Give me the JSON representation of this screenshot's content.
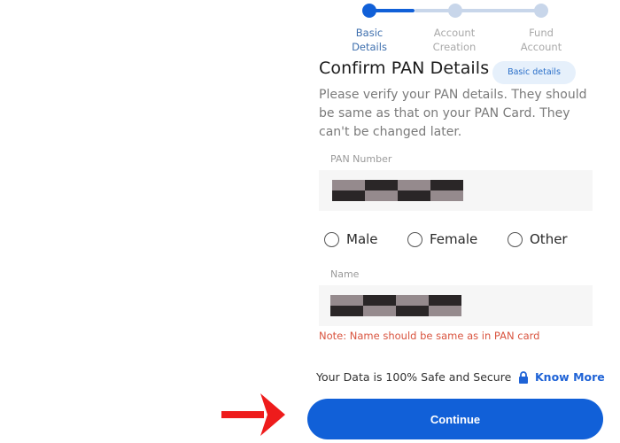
{
  "stepper": {
    "steps": [
      {
        "label_line1": "Basic",
        "label_line2": "Details",
        "state": "active"
      },
      {
        "label_line1": "Account",
        "label_line2": "Creation",
        "state": "pending"
      },
      {
        "label_line1": "Fund",
        "label_line2": "Account",
        "state": "pending"
      }
    ],
    "active_color": "#1160d8",
    "pending_color": "#c8d6ea"
  },
  "header": {
    "title": "Confirm PAN Details",
    "badge": "Basic details"
  },
  "description": "Please verify your PAN details. They should be same as that on your PAN Card. They can't be changed later.",
  "pan_field": {
    "label": "PAN Number",
    "value": "[redacted]"
  },
  "gender": {
    "options": [
      "Male",
      "Female",
      "Other"
    ],
    "selected": null
  },
  "name_field": {
    "label": "Name",
    "value": "[redacted]",
    "note": "Note: Name should be same as in PAN card"
  },
  "security": {
    "text": "Your Data is 100% Safe and Secure",
    "icon": "lock-icon",
    "link": "Know More"
  },
  "actions": {
    "continue_label": "Continue"
  },
  "annotation": {
    "icon": "arrow-right-icon",
    "color": "#ee1c1c"
  }
}
